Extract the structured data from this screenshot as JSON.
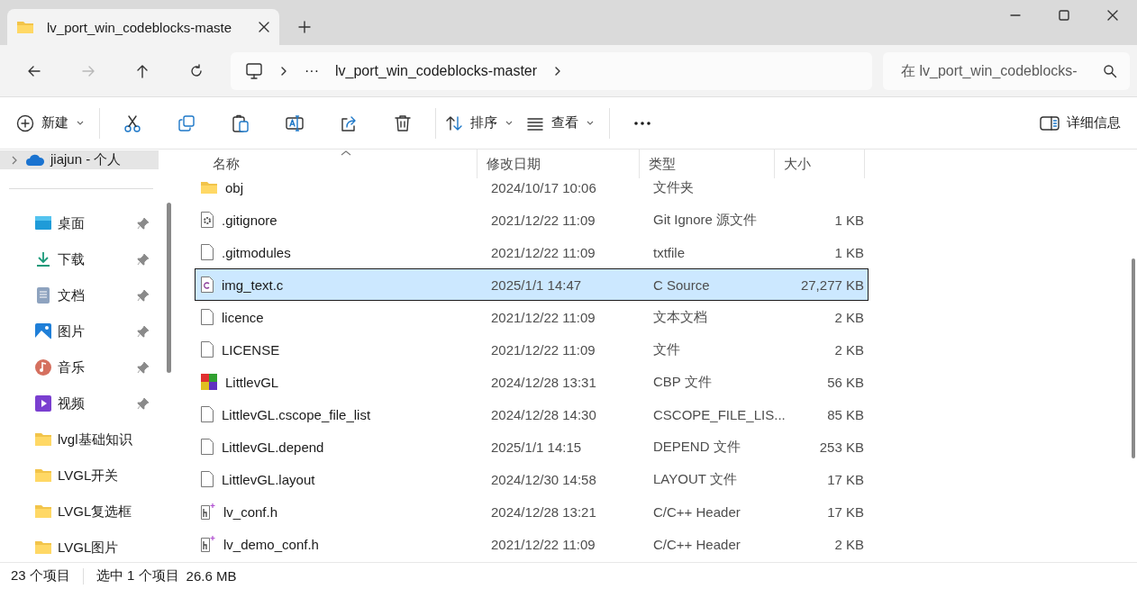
{
  "window": {
    "tab_title": "lv_port_win_codeblocks-maste",
    "tab_selected": true
  },
  "navigation": [
    {
      "kind": "back",
      "disabled": false
    },
    {
      "kind": "forward",
      "disabled": true
    },
    {
      "kind": "up",
      "disabled": false
    },
    {
      "kind": "refresh",
      "disabled": false
    }
  ],
  "address_bar": {
    "overflow": "···",
    "path": "lv_port_win_codeblocks-master"
  },
  "search": {
    "placeholder": "在 lv_port_win_codeblocks-"
  },
  "toolbar": [
    {
      "kind": "new",
      "label": "新建",
      "dropdown": true
    },
    {
      "kind": "cut"
    },
    {
      "kind": "copy"
    },
    {
      "kind": "paste"
    },
    {
      "kind": "rename"
    },
    {
      "kind": "share"
    },
    {
      "kind": "delete"
    },
    {
      "kind": "sort",
      "label": "排序",
      "dropdown": true
    },
    {
      "kind": "view",
      "label": "查看",
      "dropdown": true
    },
    {
      "kind": "more"
    }
  ],
  "details_button": {
    "label": "详细信息"
  },
  "sidebar": {
    "account": {
      "label": "jiajun - 个人",
      "expanded": false,
      "selected": true
    },
    "items": [
      {
        "kind": "desktop",
        "label": "桌面",
        "pinned": true,
        "selected": false
      },
      {
        "kind": "download",
        "label": "下载",
        "pinned": true,
        "selected": false
      },
      {
        "kind": "document",
        "label": "文档",
        "pinned": true,
        "selected": false
      },
      {
        "kind": "pictures",
        "label": "图片",
        "pinned": true,
        "selected": false
      },
      {
        "kind": "music",
        "label": "音乐",
        "pinned": true,
        "selected": false
      },
      {
        "kind": "videos",
        "label": "视频",
        "pinned": true,
        "selected": false
      },
      {
        "kind": "folder",
        "label": "lvgl基础知识",
        "pinned": false,
        "selected": false
      },
      {
        "kind": "folder",
        "label": "LVGL开关",
        "pinned": false,
        "selected": false
      },
      {
        "kind": "folder",
        "label": "LVGL复选框",
        "pinned": false,
        "selected": false
      },
      {
        "kind": "folder",
        "label": "LVGL图片",
        "pinned": false,
        "selected": false
      }
    ]
  },
  "table": {
    "columns": [
      {
        "label": "名称",
        "sorted": true
      },
      {
        "label": "修改日期",
        "sorted": false
      },
      {
        "label": "类型",
        "sorted": false
      },
      {
        "label": "大小",
        "sorted": false
      }
    ],
    "rows": [
      {
        "kind": "folder",
        "name": "obj",
        "date": "2024/10/17 10:06",
        "type": "文件夹",
        "size": "",
        "selected": false
      },
      {
        "kind": "settings-file",
        "name": ".gitignore",
        "date": "2021/12/22 11:09",
        "type": "Git Ignore 源文件",
        "size": "1 KB",
        "selected": false
      },
      {
        "kind": "file",
        "name": ".gitmodules",
        "date": "2021/12/22 11:09",
        "type": "txtfile",
        "size": "1 KB",
        "selected": false
      },
      {
        "kind": "c-file",
        "name": "img_text.c",
        "date": "2025/1/1 14:47",
        "type": "C Source",
        "size": "27,277 KB",
        "selected": true
      },
      {
        "kind": "file",
        "name": "licence",
        "date": "2021/12/22 11:09",
        "type": "文本文档",
        "size": "2 KB",
        "selected": false
      },
      {
        "kind": "file",
        "name": "LICENSE",
        "date": "2021/12/22 11:09",
        "type": "文件",
        "size": "2 KB",
        "selected": false
      },
      {
        "kind": "cbp",
        "name": "LittlevGL",
        "date": "2024/12/28 13:31",
        "type": "CBP 文件",
        "size": "56 KB",
        "selected": false
      },
      {
        "kind": "file",
        "name": "LittlevGL.cscope_file_list",
        "date": "2024/12/28 14:30",
        "type": "CSCOPE_FILE_LIS...",
        "size": "85 KB",
        "selected": false
      },
      {
        "kind": "file",
        "name": "LittlevGL.depend",
        "date": "2025/1/1 14:15",
        "type": "DEPEND 文件",
        "size": "253 KB",
        "selected": false
      },
      {
        "kind": "file",
        "name": "LittlevGL.layout",
        "date": "2024/12/30 14:58",
        "type": "LAYOUT 文件",
        "size": "17 KB",
        "selected": false
      },
      {
        "kind": "h-file",
        "name": "lv_conf.h",
        "date": "2024/12/28 13:21",
        "type": "C/C++ Header",
        "size": "17 KB",
        "selected": false
      },
      {
        "kind": "h-file",
        "name": "lv_demo_conf.h",
        "date": "2021/12/22 11:09",
        "type": "C/C++ Header",
        "size": "2 KB",
        "selected": false
      }
    ]
  },
  "status_bar": {
    "item_count": "23 个项目",
    "selection": "选中 1 个项目",
    "selection_size": "26.6 MB"
  }
}
